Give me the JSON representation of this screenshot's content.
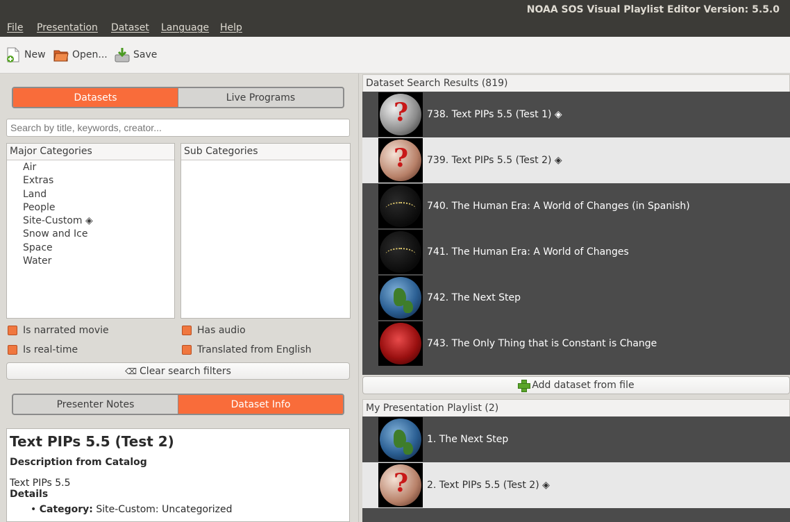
{
  "window": {
    "title": "NOAA SOS Visual Playlist Editor Version: 5.5.0"
  },
  "menu": [
    "File",
    "Presentation",
    "Dataset",
    "Language",
    "Help"
  ],
  "toolbar": {
    "new_label": "New",
    "open_label": "Open...",
    "save_label": "Save"
  },
  "left": {
    "source_tabs": [
      "Datasets",
      "Live Programs"
    ],
    "active_source_tab": "Datasets",
    "search_placeholder": "Search by title, keywords, creator...",
    "major_categories_header": "Major Categories",
    "sub_categories_header": "Sub Categories",
    "major_categories": [
      "Air",
      "Extras",
      "Land",
      "People",
      "Site-Custom ◈",
      "Snow and Ice",
      "Space",
      "Water"
    ],
    "filters": {
      "narrated": "Is narrated movie",
      "audio": "Has audio",
      "realtime": "Is real-time",
      "translated": "Translated from English"
    },
    "clear_filters_label": "Clear search filters",
    "clear_icon": "⌫",
    "info_tabs": [
      "Presenter Notes",
      "Dataset Info"
    ],
    "active_info_tab": "Dataset Info",
    "info": {
      "title": "Text PIPs 5.5 (Test 2)",
      "desc_heading": "Description from Catalog",
      "desc_text": "Text PIPs 5.5",
      "details_heading": "Details",
      "category_label": "Category:",
      "category_value": " Site-Custom: Uncategorized"
    }
  },
  "results": {
    "header": "Dataset Search Results (819)",
    "rows": [
      {
        "label": "738. Text PIPs 5.5 (Test 1) ◈",
        "thumb": "question-globe-gray",
        "selected": false
      },
      {
        "label": "739. Text PIPs 5.5 (Test 2) ◈",
        "thumb": "question-globe-brown",
        "selected": true
      },
      {
        "label": "740. The Human Era: A World of Changes (in Spanish)",
        "thumb": "night-lights-globe",
        "selected": false
      },
      {
        "label": "741. The Human Era: A World of Changes",
        "thumb": "night-lights-globe",
        "selected": false
      },
      {
        "label": "742. The Next Step",
        "thumb": "earth-globe",
        "selected": false
      },
      {
        "label": "743. The Only Thing that is Constant is Change",
        "thumb": "red-globe",
        "selected": false
      }
    ],
    "add_dataset_label": "Add dataset from file"
  },
  "playlist": {
    "header": "My Presentation Playlist (2)",
    "rows": [
      {
        "label": "1. The Next Step",
        "thumb": "earth-globe",
        "selected": false
      },
      {
        "label": "2. Text PIPs 5.5 (Test 2) ◈",
        "thumb": "question-globe-brown",
        "selected": true
      }
    ]
  },
  "colors": {
    "accent": "#f96c3a",
    "titlebar": "#3c3b37",
    "list_bg": "#4b4b4b",
    "selected_row": "#e8e8e8"
  }
}
